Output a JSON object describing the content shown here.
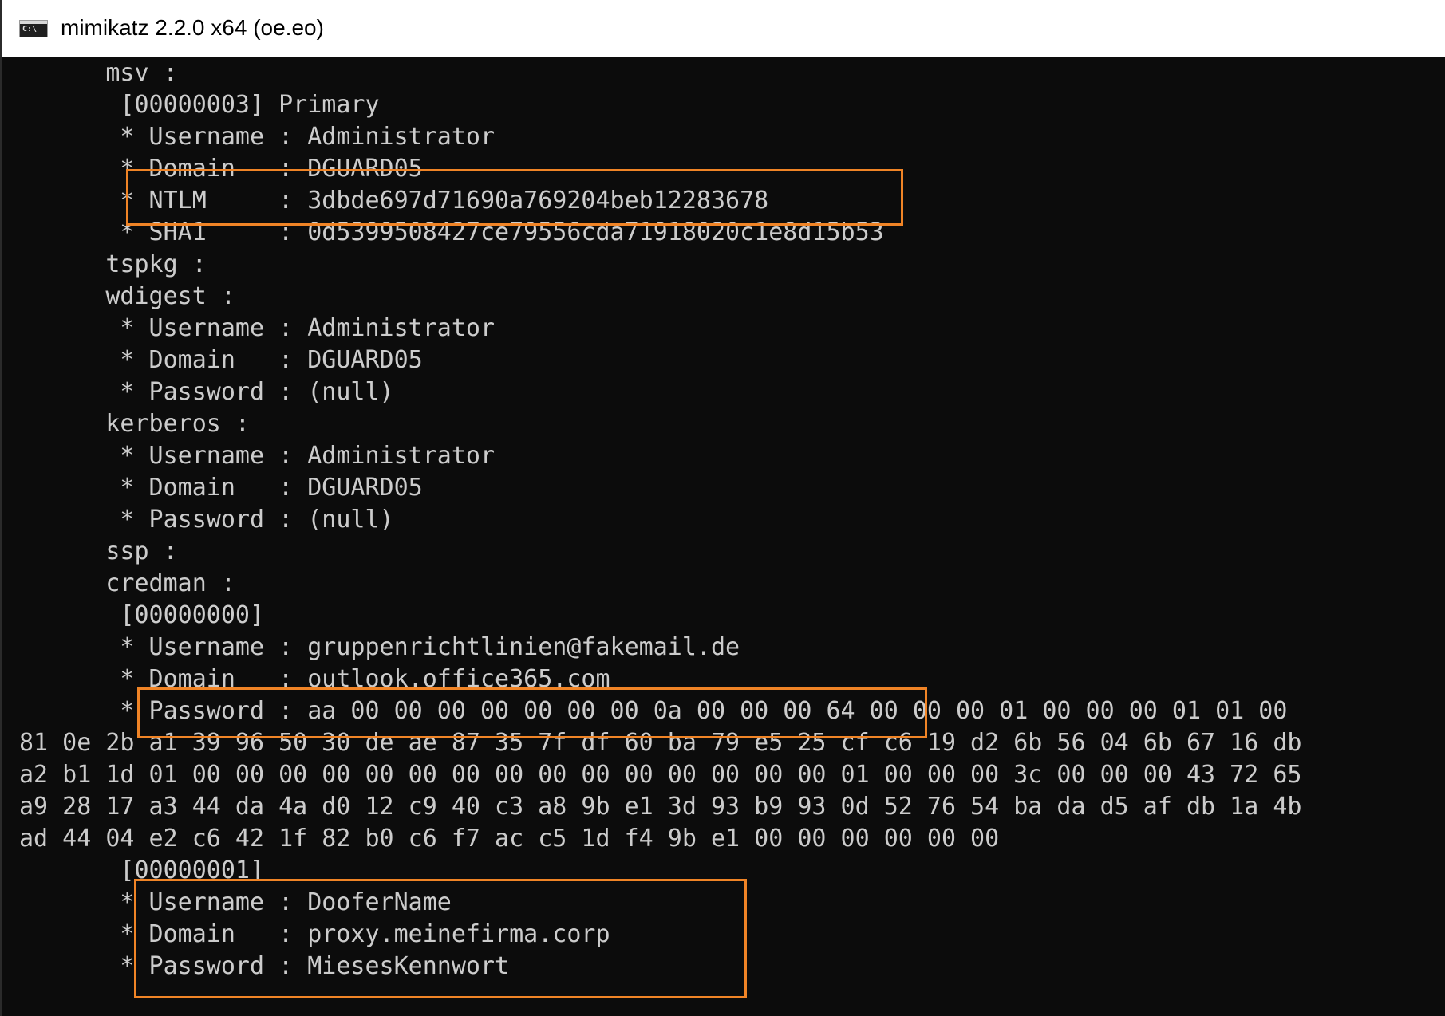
{
  "window": {
    "icon_text": "C:\\",
    "title": "mimikatz 2.2.0 x64 (oe.eo)"
  },
  "console": {
    "lines": [
      "      msv :",
      "       [00000003] Primary",
      "       * Username : Administrator",
      "       * Domain   : DGUARD05",
      "       * NTLM     : 3dbde697d71690a769204beb12283678",
      "       * SHA1     : 0d5399508427ce79556cda71918020c1e8d15b53",
      "      tspkg :",
      "      wdigest :",
      "       * Username : Administrator",
      "       * Domain   : DGUARD05",
      "       * Password : (null)",
      "      kerberos :",
      "       * Username : Administrator",
      "       * Domain   : DGUARD05",
      "       * Password : (null)",
      "      ssp :",
      "      credman :",
      "       [00000000]",
      "       * Username : gruppenrichtlinien@fakemail.de",
      "       * Domain   : outlook.office365.com",
      "       * Password : aa 00 00 00 00 00 00 00 0a 00 00 00 64 00 00 00 01 00 00 00 01 01 00",
      "81 0e 2b a1 39 96 50 30 de ae 87 35 7f df 60 ba 79 e5 25 cf c6 19 d2 6b 56 04 6b 67 16 db",
      "a2 b1 1d 01 00 00 00 00 00 00 00 00 00 00 00 00 00 00 00 01 00 00 00 3c 00 00 00 43 72 65",
      "a9 28 17 a3 44 da 4a d0 12 c9 40 c3 a8 9b e1 3d 93 b9 93 0d 52 76 54 ba da d5 af db 1a 4b",
      "ad 44 04 e2 c6 42 1f 82 b0 c6 f7 ac c5 1d f4 9b e1 00 00 00 00 00 00",
      "       [00000001]",
      "       * Username : DooferName",
      "       * Domain   : proxy.meinefirma.corp",
      "       * Password : MiesesKennwort"
    ]
  },
  "colors": {
    "console_bg": "#0c0c0c",
    "console_text": "#cccccc",
    "highlight": "#f08426",
    "titlebar_bg": "#ffffff"
  }
}
